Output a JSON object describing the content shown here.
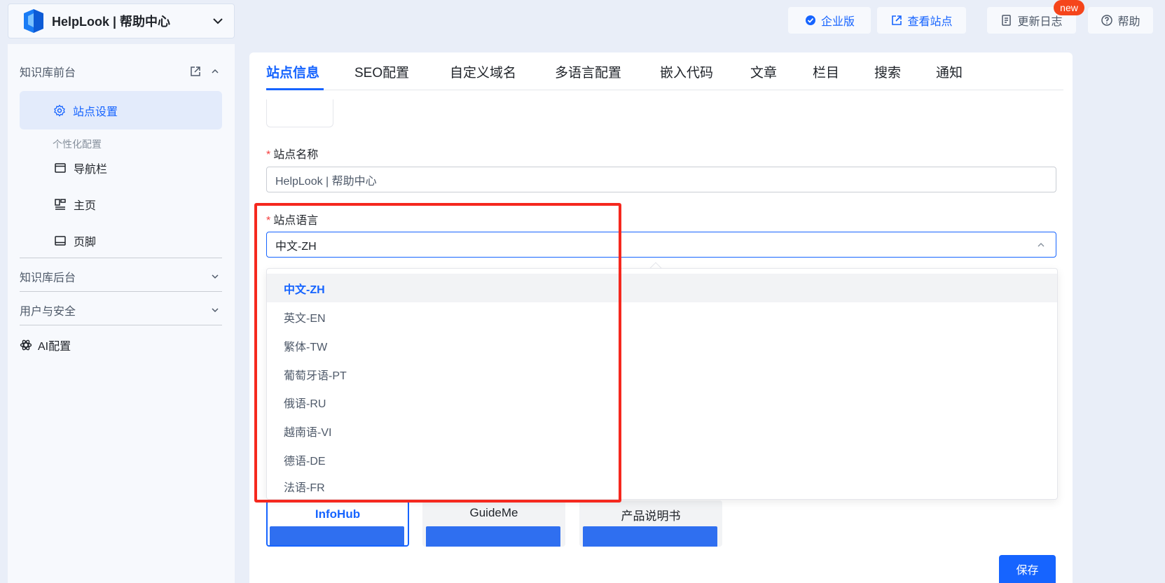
{
  "brand": {
    "name": "HelpLook | 帮助中心"
  },
  "topbar": {
    "enterprise": "企业版",
    "view_site": "查看站点",
    "changelog": "更新日志",
    "help": "帮助",
    "new_badge": "new"
  },
  "sidebar": {
    "group_frontend": "知识库前台",
    "active_item": "站点设置",
    "sub_heading": "个性化配置",
    "items": [
      "导航栏",
      "主页",
      "页脚"
    ],
    "group_backend": "知识库后台",
    "group_security": "用户与安全",
    "ai_config": "AI配置"
  },
  "tabs": [
    "站点信息",
    "SEO配置",
    "自定义域名",
    "多语言配置",
    "嵌入代码",
    "文章",
    "栏目",
    "搜索",
    "通知"
  ],
  "form": {
    "site_name_label": "站点名称",
    "site_name_value": "HelpLook | 帮助中心",
    "site_lang_label": "站点语言",
    "site_lang_value": "中文-ZH",
    "required_mark": "*"
  },
  "language_options": [
    "中文-ZH",
    "英文-EN",
    "繁体-TW",
    "葡萄牙语-PT",
    "俄语-RU",
    "越南语-VI",
    "德语-DE",
    "法语-FR"
  ],
  "themes": [
    "InfoHub",
    "GuideMe",
    "产品说明书"
  ],
  "save_label": "保存",
  "colors": {
    "accent": "#1664ff",
    "highlight": "#f5281e",
    "badge": "#f5451b"
  }
}
